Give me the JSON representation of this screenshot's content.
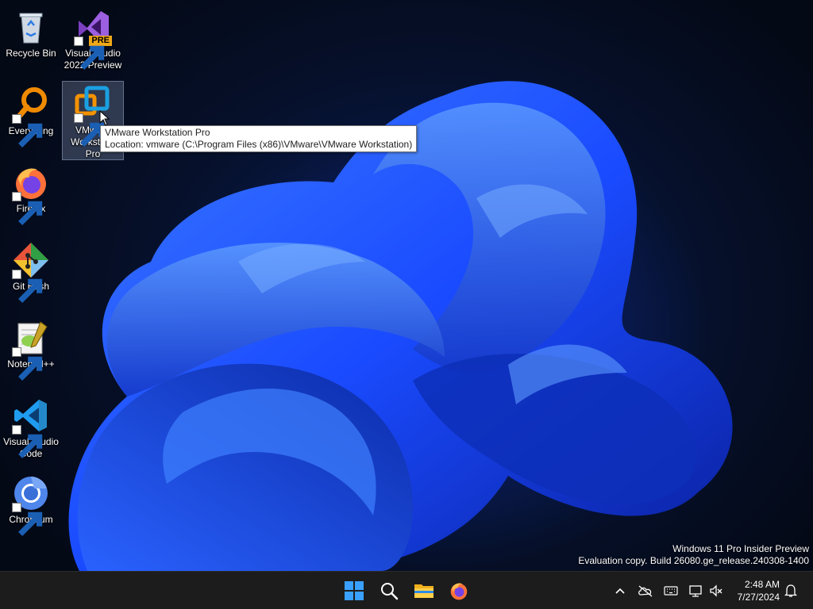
{
  "desktop_icons": [
    {
      "id": "recycle-bin",
      "label": "Recycle Bin",
      "icon": "recycle-bin-icon"
    },
    {
      "id": "visual-studio-2022-preview",
      "label": "Visual Studio 2022 Preview",
      "badge": "PRE",
      "icon": "visual-studio-preview-icon"
    },
    {
      "id": "everything",
      "label": "Everything",
      "icon": "everything-search-icon"
    },
    {
      "id": "vmware-workstation-pro",
      "label": "VMware Workstation Pro",
      "icon": "vmware-icon",
      "selected": true
    },
    {
      "id": "firefox",
      "label": "Firefox",
      "icon": "firefox-icon"
    },
    {
      "id": "git-bash",
      "label": "Git Bash",
      "icon": "git-icon"
    },
    {
      "id": "notepad-plus-plus",
      "label": "Notepad++",
      "icon": "notepad-plus-plus-icon"
    },
    {
      "id": "visual-studio-code",
      "label": "Visual Studio Code",
      "icon": "vscode-icon"
    },
    {
      "id": "chromium",
      "label": "Chromium",
      "icon": "chromium-icon"
    }
  ],
  "tooltip": {
    "title": "VMware Workstation Pro",
    "location": "Location: vmware (C:\\Program Files (x86)\\VMware\\VMware Workstation)"
  },
  "watermark": {
    "line1": "Windows 11 Pro Insider Preview",
    "line2": "Evaluation copy. Build 26080.ge_release.240308-1400"
  },
  "taskbar": {
    "pinned": [
      "start-icon",
      "search-icon",
      "file-explorer-icon",
      "firefox-icon"
    ],
    "tray": [
      "chevron-up-icon",
      "onedrive-offline-icon",
      "keyboard-icon",
      "network-icon",
      "volume-muted-icon"
    ],
    "clock": {
      "time": "2:48 AM",
      "date": "7/27/2024"
    },
    "notification_icon": "bell-icon"
  },
  "colors": {
    "taskbar": "#1c1c1c",
    "accent": "#0f6cbd",
    "wallpaper_dark": "#050b1a",
    "bloom": "#1a4bff"
  }
}
